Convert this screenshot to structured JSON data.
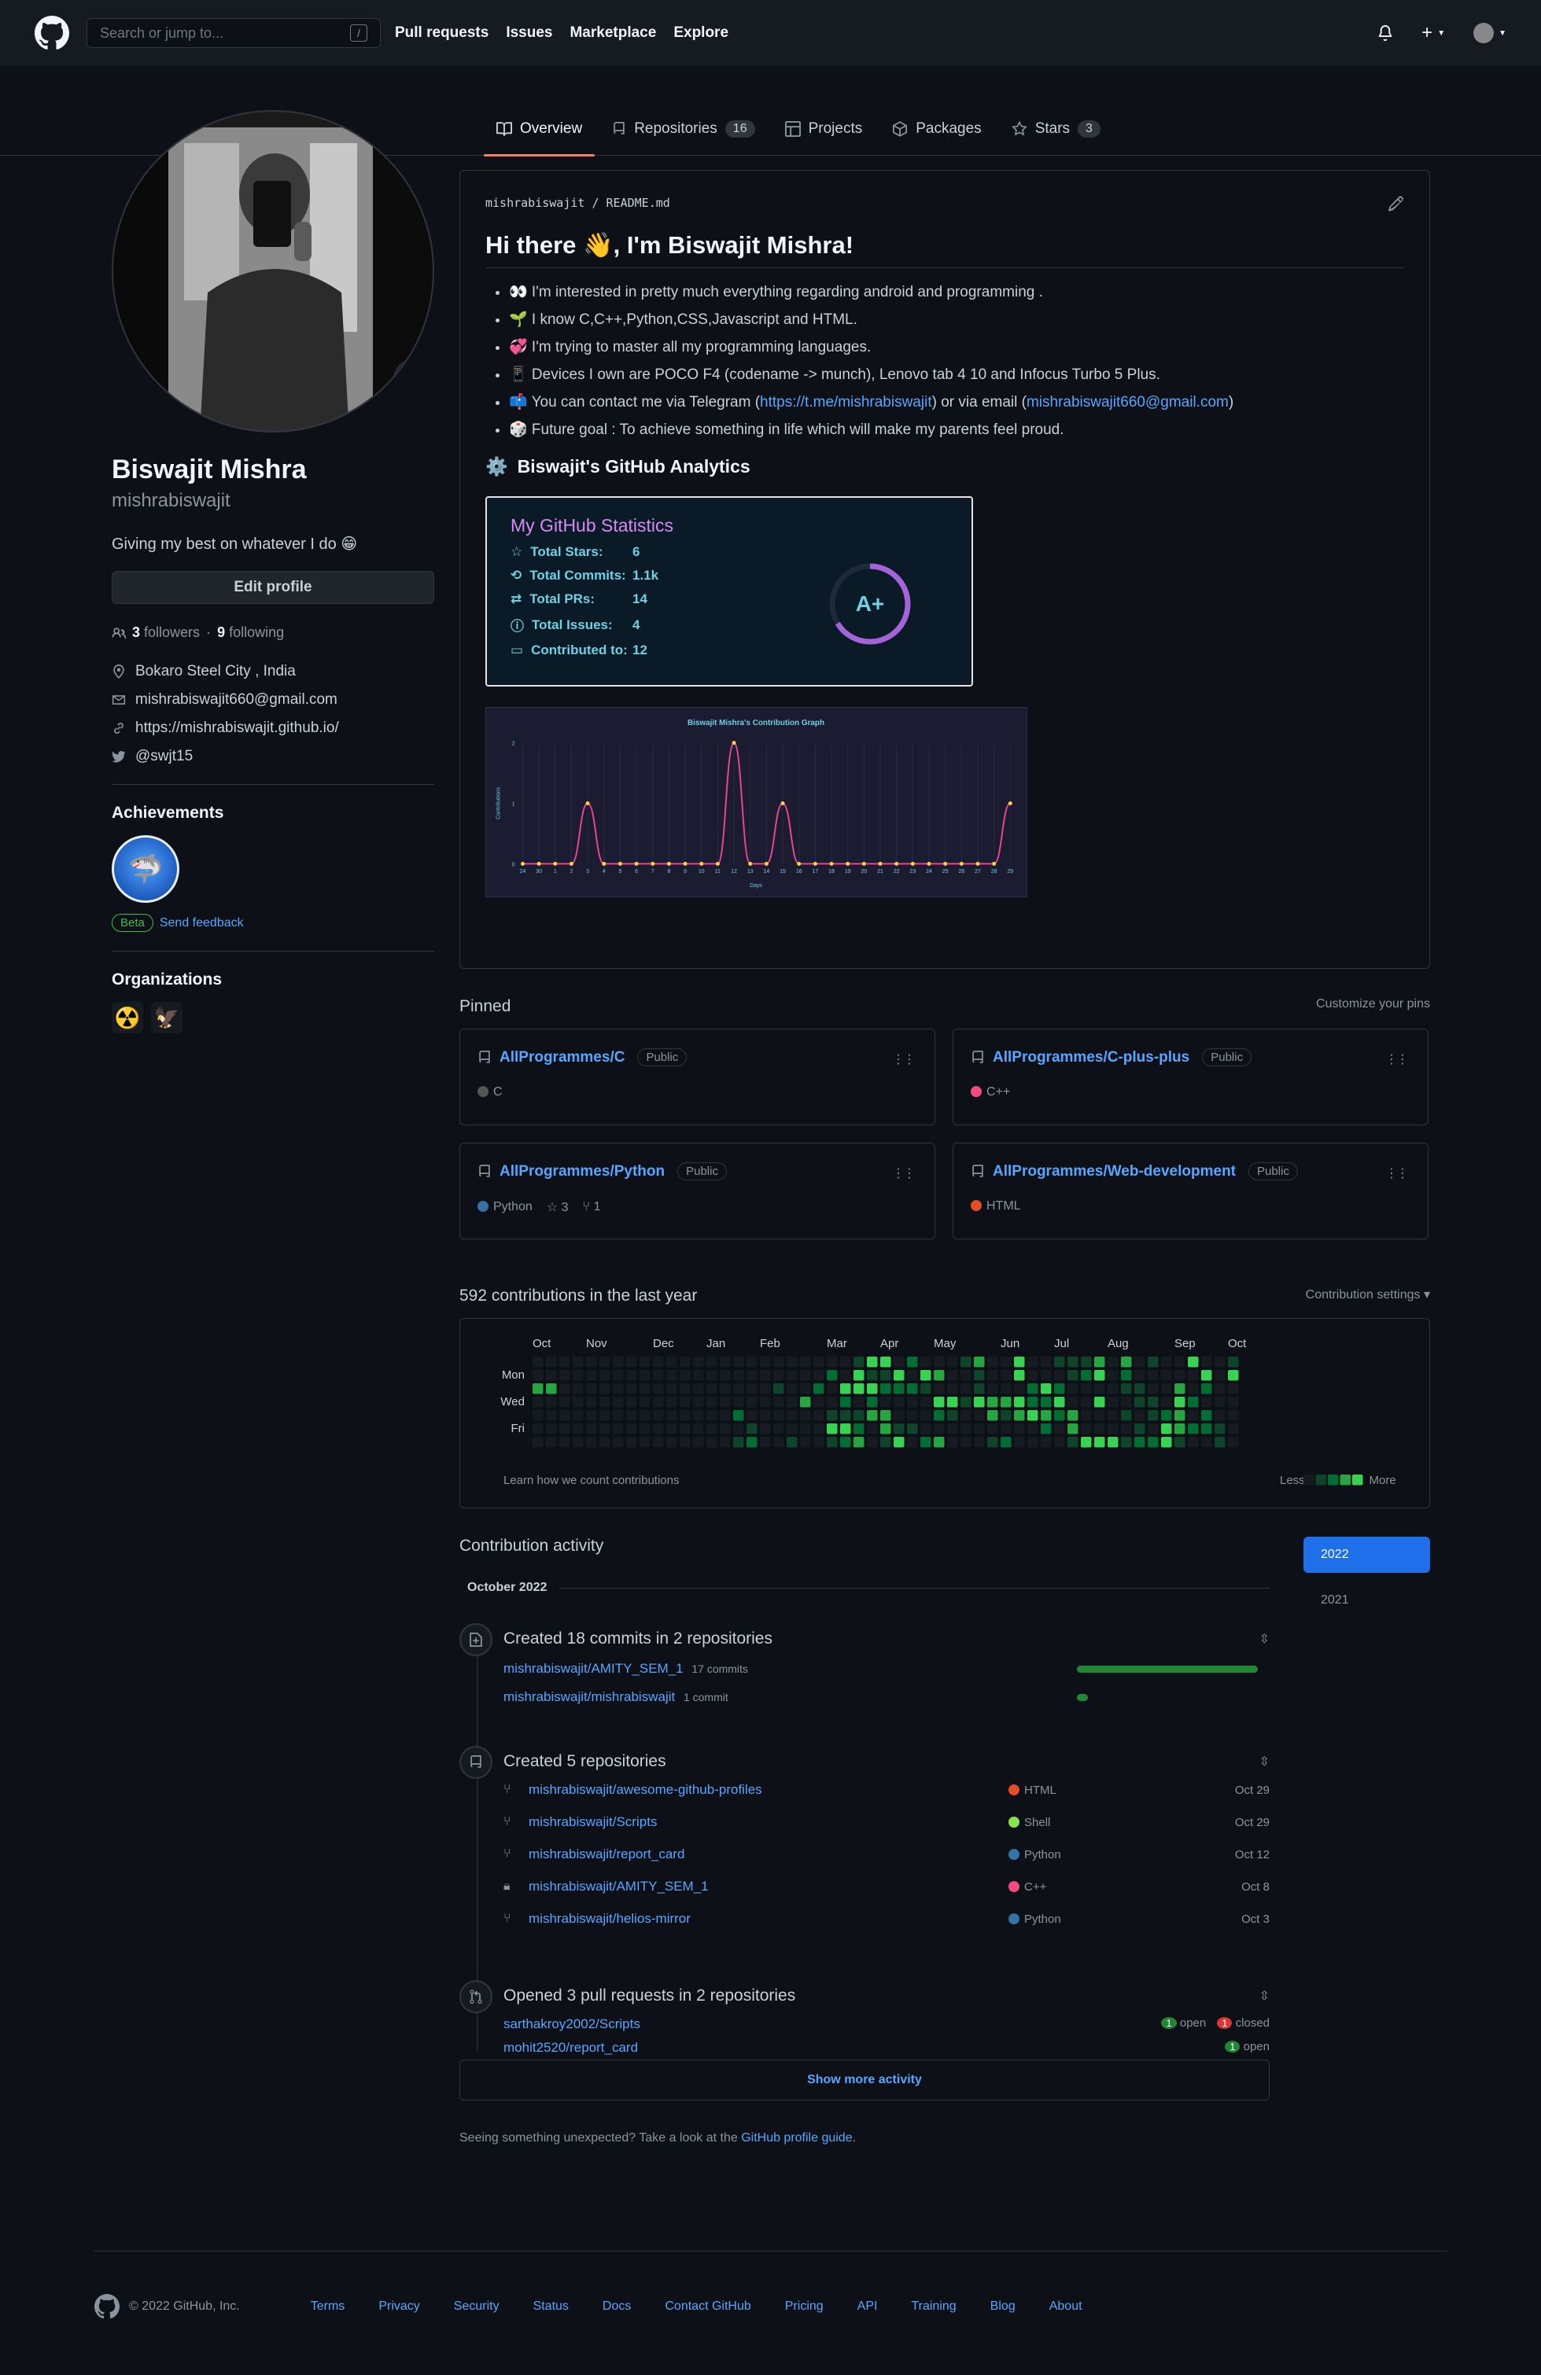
{
  "header": {
    "search_placeholder": "Search or jump to...",
    "search_key": "/",
    "nav": [
      "Pull requests",
      "Issues",
      "Marketplace",
      "Explore"
    ]
  },
  "tabs": [
    {
      "label": "Overview"
    },
    {
      "label": "Repositories",
      "count": "16"
    },
    {
      "label": "Projects"
    },
    {
      "label": "Packages"
    },
    {
      "label": "Stars",
      "count": "3"
    }
  ],
  "profile": {
    "name": "Biswajit Mishra",
    "login": "mishrabiswajit",
    "bio": "Giving my best on whatever I do 😁",
    "edit_label": "Edit profile",
    "followers": "3",
    "followers_label": "followers",
    "following": "9",
    "following_label": "following",
    "location": "Bokaro Steel City , India",
    "email": "mishrabiswajit660@gmail.com",
    "website": "https://mishrabiswajit.github.io/",
    "twitter": "@swjt15",
    "status_emoji": "🎯"
  },
  "achievements": {
    "title": "Achievements",
    "beta": "Beta",
    "feedback": "Send feedback"
  },
  "organizations": {
    "title": "Organizations"
  },
  "readme": {
    "path_user": "mishrabiswajit",
    "path_sep": "/",
    "path_file": "README.md",
    "title": "Hi there 👋, I'm Biswajit Mishra!",
    "items": [
      "👀 I'm interested in pretty much everything regarding android and programming .",
      "🌱 I know C,C++,Python,CSS,Javascript and HTML.",
      "💞️ I'm trying to master all my programming languages.",
      "📱 Devices I own are POCO F4 (codename -> munch), Lenovo tab 4 10 and Infocus Turbo 5 Plus.",
      "📫 You can contact me via Telegram (",
      "🎲 Future goal : To achieve something in life which will make my parents feel proud."
    ],
    "contact_link1": "https://t.me/mishrabiswajit",
    "contact_mid": ") or via email (",
    "contact_link2": "mishrabiswajit660@gmail.com",
    "contact_end": ")",
    "analytics_title": "Biswajit's GitHub Analytics",
    "stats": {
      "title": "My GitHub Statistics",
      "rows": [
        {
          "k": "Total Stars:",
          "v": "6"
        },
        {
          "k": "Total Commits:",
          "v": "1.1k"
        },
        {
          "k": "Total PRs:",
          "v": "14"
        },
        {
          "k": "Total Issues:",
          "v": "4"
        },
        {
          "k": "Contributed to:",
          "v": "12"
        }
      ],
      "grade": "A+"
    }
  },
  "chart_data": {
    "type": "line",
    "title": "Biswajit Mishra's Contribution Graph",
    "xlabel": "Days",
    "ylabel": "Contributions",
    "x": [
      "24",
      "30",
      "1",
      "2",
      "3",
      "4",
      "5",
      "6",
      "7",
      "8",
      "9",
      "10",
      "11",
      "12",
      "13",
      "14",
      "15",
      "16",
      "17",
      "18",
      "19",
      "20",
      "21",
      "22",
      "23",
      "24",
      "25",
      "26",
      "27",
      "28",
      "29"
    ],
    "values": [
      0,
      0,
      0,
      0,
      1,
      0,
      0,
      0,
      0,
      0,
      0,
      0,
      0,
      2,
      0,
      0,
      1,
      0,
      0,
      0,
      0,
      0,
      0,
      0,
      0,
      0,
      0,
      0,
      0,
      0,
      1
    ],
    "ylim": [
      0,
      2
    ],
    "yticks": [
      "0",
      "1",
      "2"
    ],
    "colors": {
      "line": "#e8468b",
      "point": "#ffd24a",
      "bg": "#1b1b31"
    }
  },
  "pinned": {
    "title": "Pinned",
    "customize": "Customize your pins",
    "public": "Public",
    "items": [
      {
        "name": "AllProgrammes/C",
        "lang": "C",
        "color": "#555555"
      },
      {
        "name": "AllProgrammes/C-plus-plus",
        "lang": "C++",
        "color": "#f34b7d"
      },
      {
        "name": "AllProgrammes/Python",
        "lang": "Python",
        "color": "#3572A5",
        "stars": "3",
        "forks": "1"
      },
      {
        "name": "AllProgrammes/Web-development",
        "lang": "HTML",
        "color": "#e34c26"
      }
    ]
  },
  "contrib": {
    "title": "592 contributions in the last year",
    "settings": "Contribution settings ▾",
    "months": [
      "Oct",
      "Nov",
      "Dec",
      "Jan",
      "Feb",
      "Mar",
      "Apr",
      "May",
      "Jun",
      "Jul",
      "Aug",
      "Sep",
      "Oct"
    ],
    "days": [
      "Mon",
      "Wed",
      "Fri"
    ],
    "learn": "Learn how we count contributions",
    "less": "Less",
    "more": "More"
  },
  "activity": {
    "title": "Contribution activity",
    "month": "October 2022",
    "years": [
      "2022",
      "2021"
    ],
    "commits": {
      "title": "Created 18 commits in 2 repositories",
      "rows": [
        {
          "repo": "mishrabiswajit/AMITY_SEM_1",
          "n": "17 commits",
          "frac": 1.0
        },
        {
          "repo": "mishrabiswajit/mishrabiswajit",
          "n": "1 commit",
          "frac": 0.06
        }
      ]
    },
    "repos": {
      "title": "Created 5 repositories",
      "rows": [
        {
          "name": "mishrabiswajit/awesome-github-profiles",
          "lang": "HTML",
          "color": "#e34c26",
          "date": "Oct 29",
          "icon": "fork"
        },
        {
          "name": "mishrabiswajit/Scripts",
          "lang": "Shell",
          "color": "#89e051",
          "date": "Oct 29",
          "icon": "fork"
        },
        {
          "name": "mishrabiswajit/report_card",
          "lang": "Python",
          "color": "#3572A5",
          "date": "Oct 12",
          "icon": "fork"
        },
        {
          "name": "mishrabiswajit/AMITY_SEM_1",
          "lang": "C++",
          "color": "#f34b7d",
          "date": "Oct 8",
          "icon": "lock"
        },
        {
          "name": "mishrabiswajit/helios-mirror",
          "lang": "Python",
          "color": "#3572A5",
          "date": "Oct 3",
          "icon": "fork"
        }
      ]
    },
    "prs": {
      "title": "Opened 3 pull requests in 2 repositories",
      "rows": [
        {
          "repo": "sarthakroy2002/Scripts",
          "open": "1",
          "open_label": "open",
          "closed": "1",
          "closed_label": "closed"
        },
        {
          "repo": "mohit2520/report_card",
          "open": "1",
          "open_label": "open"
        }
      ]
    },
    "show_more": "Show more activity",
    "note_pre": "Seeing something unexpected? Take a look at the ",
    "note_link": "GitHub profile guide",
    "note_post": "."
  },
  "footer": {
    "copy": "© 2022 GitHub, Inc.",
    "links": [
      "Terms",
      "Privacy",
      "Security",
      "Status",
      "Docs",
      "Contact GitHub",
      "Pricing",
      "API",
      "Training",
      "Blog",
      "About"
    ]
  }
}
